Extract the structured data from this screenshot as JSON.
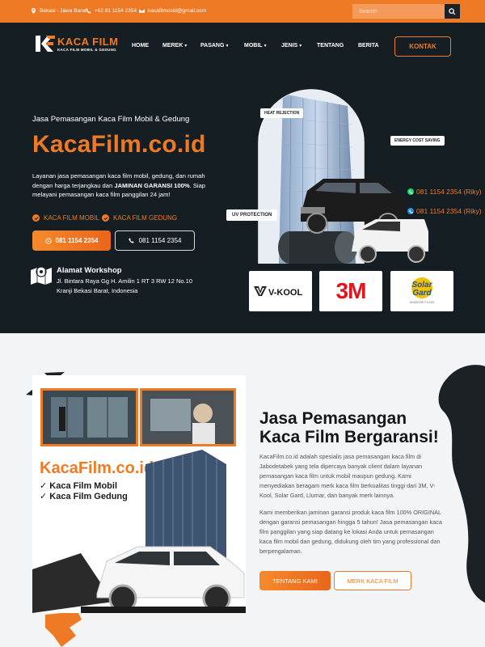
{
  "topbar": {
    "location": "Bekasi - Jawa Barat",
    "phone": "+62 81 1154 2354",
    "email": "kacafilmcoid@gmail.com",
    "search_placeholder": "Search"
  },
  "logo": {
    "title": "KACA FILM",
    "subtitle": "KACA FILM MOBIL & GEDUNG"
  },
  "nav": {
    "items": [
      {
        "label": "HOME",
        "dropdown": false
      },
      {
        "label": "MEREK",
        "dropdown": true
      },
      {
        "label": "PASANG",
        "dropdown": true
      },
      {
        "label": "MOBIL",
        "dropdown": true
      },
      {
        "label": "JENIS",
        "dropdown": true
      },
      {
        "label": "TENTANG",
        "dropdown": false
      },
      {
        "label": "BERITA",
        "dropdown": false
      }
    ],
    "contact_label": "KONTAK"
  },
  "hero": {
    "tagline": "Jasa Pemasangan Kaca Film Mobil & Gedung",
    "title": "KacaFilm.co.id",
    "desc_part1": "Layanan jasa pemasangan kaca film mobil, gedung, dan rumah dengan harga terjangkau dan ",
    "desc_bold": "JAMINAN GARANSI 100%",
    "desc_part2": ". Siap melayani pemasangan kaca film panggilan 24 jam!",
    "checks": [
      "KACA FILM MOBIL",
      "KACA FILM GEDUNG"
    ],
    "whatsapp_label": "081 1154 2354",
    "call_label": "081 1154 2354",
    "address_title": "Alamat Workshop",
    "address_text": "Jl. Bintara Raya Gg H. Amilin 1 RT 3 RW 12 No.10 Kranji Bekasi Barat, Indonesia",
    "tags": {
      "heat": "HEAT REJECTION",
      "energy": "ENERGY COST SAVING",
      "uv": "UV PROTECTION"
    },
    "phone_badges": [
      "081 1154 2354 (Riky)",
      "081 1154 2354 (Riky)"
    ],
    "brands": [
      "V-KOOL",
      "3M",
      "Solar Gard"
    ],
    "brand_solar_sub": "WINDOW FILMS"
  },
  "section2": {
    "promo_title": "KacaFilm.co.id",
    "promo_items": [
      "Kaca Film Mobil",
      "Kaca Film Gedung"
    ],
    "title_line1": "Jasa Pemasangan",
    "title_line2": "Kaca Film Bergaransi!",
    "paragraph1": "KacaFilm.co.id adalah spesialis jasa pemasangan kaca film di Jabodetabek yang tela dipercaya banyak client dalam layanan pemasangan kaca film untuk mobil maupun gedung. Kami menyediakan beragam merk kaca film berkualitas tinggi dari 3M, V-Kool, Solar Gard, Llumar, dan banyak merk lainnya.",
    "paragraph2": "Kami memberikan jaminan garansi produk kaca film 100% ORIGINAL dengan garansi pemasangan hingga 5 tahun! Jasa pemasangan kaca film panggilan yang siap datang ke lokasi Anda untuk pemasangan kaca film mobil dan gedung, didukung oleh tim yang professional dan berpengalaman.",
    "btn_about": "TENTANG KAMI",
    "btn_brand": "MERK KACA FILM"
  },
  "colors": {
    "accent": "#ef7a25",
    "dark": "#151e22",
    "light_bg": "#f3f4f6"
  }
}
